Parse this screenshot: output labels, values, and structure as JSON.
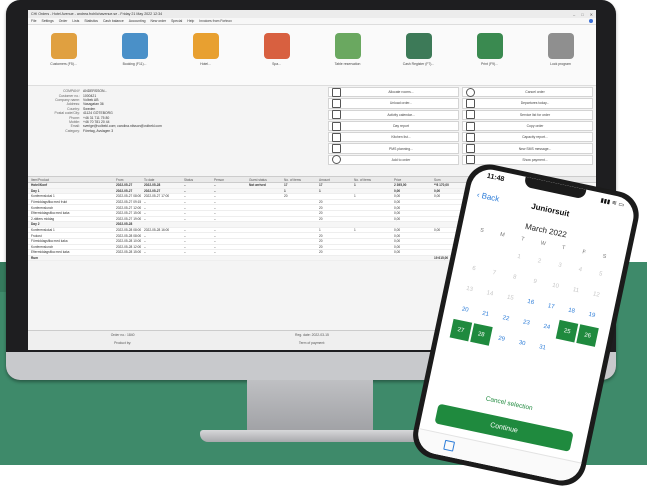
{
  "window": {
    "title": "CHI Orders - Hotel Avenue - andrea.frohlichavenue.se - Friday 21 May 2022 12:34",
    "controls": [
      "–",
      "□",
      "✕"
    ]
  },
  "menu": [
    "File",
    "Settings",
    "Order",
    "Lists",
    "Statistics",
    "Cash balance",
    "Accounting",
    "New order",
    "Special",
    "Help",
    "Invoices from Fortnox"
  ],
  "ribbon": [
    {
      "label": "Customers (F5)...",
      "icon": "customers-icon",
      "color": "#e0a040"
    },
    {
      "label": "Booking (F11)...",
      "icon": "calendar-icon",
      "color": "#4a90c8"
    },
    {
      "label": "Hotel...",
      "icon": "star-icon",
      "color": "#e8a030"
    },
    {
      "label": "Spa...",
      "icon": "spa-icon",
      "color": "#d86040"
    },
    {
      "label": "Table reservation",
      "icon": "table-icon",
      "color": "#6aa860"
    },
    {
      "label": "Cash Register (F7)...",
      "icon": "cash-register-icon",
      "color": "#3d7a58"
    },
    {
      "label": "Print (F9)...",
      "icon": "print-icon",
      "color": "#3a8a50"
    },
    {
      "label": "Lock program",
      "icon": "lock-icon",
      "color": "#8f8f8f"
    }
  ],
  "customer": [
    {
      "k": "COMPANY",
      "v": "ANDERSSON..."
    },
    {
      "k": "Customer no.:",
      "v": "1000421"
    },
    {
      "k": "Company name:",
      "v": "Volbek AB"
    },
    {
      "k": "Address:",
      "v": "Vasagatan 36"
    },
    {
      "k": "Country:",
      "v": "Sweden"
    },
    {
      "k": "Postal code/City:",
      "v": "41124 GÖTEBORG"
    },
    {
      "k": "Phone:",
      "v": "+46 31 711 75 80"
    },
    {
      "k": "Mobile:",
      "v": "+46 70 781 20 44"
    },
    {
      "k": "Email:",
      "v": "sverige@volbekl.com; carolina.nilsson@volbekl.com"
    },
    {
      "k": "Category:",
      "v": "Företag, Avslagen 3"
    }
  ],
  "actions": [
    {
      "label": "Allocate rooms...",
      "icon": "allocate-icon",
      "round": false
    },
    {
      "label": "Cancel order",
      "icon": "cancel-icon",
      "round": true
    },
    {
      "label": "Unload order...",
      "icon": "download-icon",
      "round": false
    },
    {
      "label": "Departures today...",
      "icon": "departure-icon",
      "round": false
    },
    {
      "label": "Activity calendar...",
      "icon": "calendar-small-icon",
      "round": false
    },
    {
      "label": "Service list for order",
      "icon": "service-list-icon",
      "round": false
    },
    {
      "label": "Day report",
      "icon": "day-report-icon",
      "round": false
    },
    {
      "label": "Copy order",
      "icon": "copy-icon",
      "round": false
    },
    {
      "label": "Kitchen list...",
      "icon": "kitchen-list-icon",
      "round": false
    },
    {
      "label": "Capacity report...",
      "icon": "capacity-icon",
      "round": false
    },
    {
      "label": "PMS planning...",
      "icon": "planning-icon",
      "round": false
    },
    {
      "label": "New SMS message...",
      "icon": "phone-icon",
      "round": false
    },
    {
      "label": "Add to order",
      "icon": "add-icon",
      "round": true
    },
    {
      "label": "Show payment...",
      "icon": "payment-icon",
      "round": false
    }
  ],
  "grid": {
    "headers": [
      "Item/Product",
      "From",
      "To date",
      "Status",
      "Person",
      "Guest status",
      "No. of items",
      "Amount",
      "No. of items",
      "Price",
      "Sum",
      "Price detail",
      "Price inc. VAT",
      "Sum inc. VAT"
    ],
    "rows": [
      {
        "group": true,
        "c": [
          "Hotel/Konf",
          "2022-05-27",
          "2022-05-28",
          "–",
          "–",
          "Not arrived",
          "17",
          "17",
          "1",
          "2 395,00",
          "**8 170,00",
          "Konferenspaket",
          "1 476,00",
          "*91 9xx"
        ]
      },
      {
        "group": true,
        "c": [
          "Day 1",
          "2022-05-27",
          "2022-05-27",
          "–",
          "–",
          "",
          "1",
          "1",
          "",
          "0,00",
          "0,00",
          "",
          "0,00",
          "0,0"
        ]
      },
      {
        "group": false,
        "c": [
          "Konferenslokal 1",
          "2022-05-27 08:00",
          "2022-05-27 17:00",
          "–",
          "–",
          "",
          "20",
          "",
          "1",
          "0,00",
          "0,00",
          "Konferenslokal",
          "",
          "0,0"
        ]
      },
      {
        "group": false,
        "c": [
          "Förmiddagsfika med frukt",
          "2022-05-27 09:15",
          "–",
          "–",
          "–",
          "",
          "",
          "20",
          "",
          "0,00",
          "",
          "",
          "",
          ""
        ]
      },
      {
        "group": false,
        "c": [
          "Konferenslunch",
          "2022-05-27 12:00",
          "–",
          "–",
          "–",
          "",
          "",
          "20",
          "",
          "0,00",
          "",
          "",
          "",
          ""
        ]
      },
      {
        "group": false,
        "c": [
          "Eftermiddagsfika med kaka",
          "2022-05-27 15:00",
          "–",
          "–",
          "–",
          "",
          "",
          "20",
          "",
          "0,00",
          "",
          "",
          "",
          ""
        ]
      },
      {
        "group": false,
        "c": [
          "2-rätters middag",
          "2022-05-27 19:00",
          "–",
          "–",
          "–",
          "",
          "",
          "20",
          "",
          "0,00",
          "",
          "",
          "",
          ""
        ]
      },
      {
        "group": true,
        "c": [
          "Day 2",
          "2022-05-28",
          "",
          "",
          "",
          "",
          "",
          "",
          "",
          "",
          "",
          "",
          "",
          ""
        ]
      },
      {
        "group": false,
        "c": [
          "Konferenslokal 1",
          "2022-05-28 08:00",
          "2022-05-28 16:00",
          "–",
          "–",
          "",
          "",
          "1",
          "1",
          "0,00",
          "0,00",
          "Konferenslokal",
          "",
          ""
        ]
      },
      {
        "group": false,
        "c": [
          "Frukost",
          "2022-05-28 08:00",
          "–",
          "–",
          "–",
          "",
          "",
          "20",
          "",
          "0,00",
          "",
          "",
          "",
          ""
        ]
      },
      {
        "group": false,
        "c": [
          "Förmiddagsfika med kaka",
          "2022-05-28 10:00",
          "–",
          "–",
          "–",
          "",
          "",
          "20",
          "",
          "0,00",
          "",
          "",
          "",
          ""
        ]
      },
      {
        "group": false,
        "c": [
          "Konferenslunch",
          "2022-05-28 12:00",
          "–",
          "–",
          "–",
          "",
          "",
          "20",
          "",
          "0,00",
          "",
          "",
          "",
          ""
        ]
      },
      {
        "group": false,
        "c": [
          "Eftermiddagsfika med kaka",
          "2022-05-28 15:00",
          "–",
          "–",
          "–",
          "",
          "",
          "20",
          "",
          "0,00",
          "",
          "",
          "",
          ""
        ]
      },
      {
        "group": true,
        "c": [
          "Rum",
          "",
          "",
          "",
          "",
          "",
          "",
          "",
          "",
          "",
          "19 615,00",
          "",
          "",
          ""
        ]
      }
    ],
    "total": "19 615,00"
  },
  "footer": {
    "row1": [
      "Order no.: 1840",
      "Reg. date: 2022-03-15",
      "Created by: AH"
    ],
    "row2": [
      "Product by:",
      "Term of payment:",
      "Status: Booked 2022-03-15"
    ]
  },
  "phone": {
    "time": "11:48",
    "status": "▮▮▮ ≋ ▭",
    "back": "‹ Back",
    "title": "Juniorsuit",
    "month": "March 2022",
    "weekdays": [
      "S",
      "M",
      "T",
      "W",
      "T",
      "F",
      "S"
    ],
    "days": [
      "",
      "",
      "1",
      "2",
      "3",
      "4",
      "5",
      "6",
      "7",
      "8",
      "9",
      "10",
      "11",
      "12",
      "13",
      "14",
      "15",
      "16",
      "17",
      "18",
      "19",
      "20",
      "21",
      "22",
      "23",
      "24",
      "25",
      "26",
      "27",
      "28",
      "29",
      "30",
      "31",
      "",
      ""
    ],
    "selected": [
      "25",
      "26",
      "27",
      "28"
    ],
    "past_until": 16,
    "cancel": "Cancel selection",
    "continue": "Continue"
  }
}
